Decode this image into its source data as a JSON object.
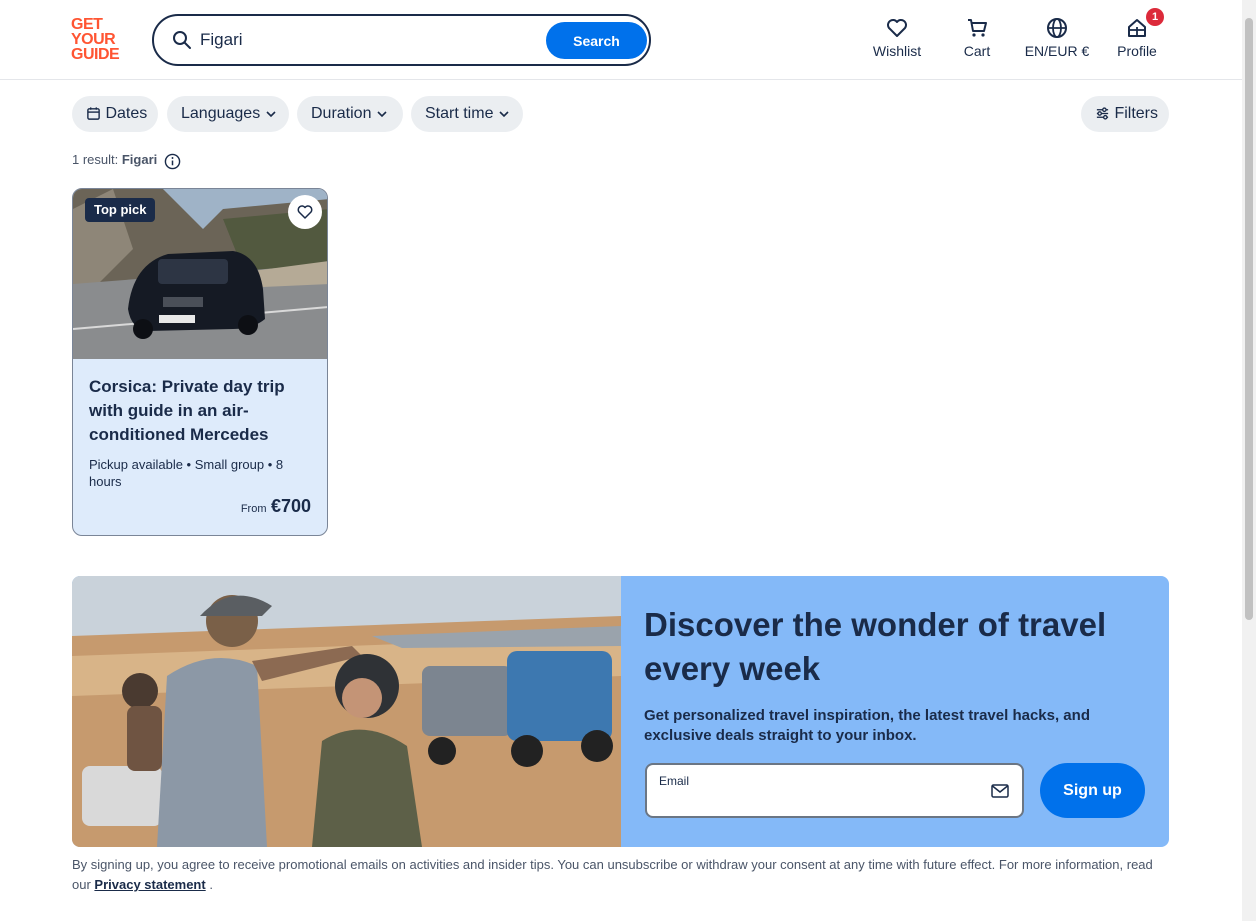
{
  "header": {
    "logo_lines": [
      "GET",
      "YOUR",
      "GUIDE"
    ],
    "search": {
      "value": "Figari",
      "button_label": "Search"
    },
    "nav": {
      "wishlist": "Wishlist",
      "cart": "Cart",
      "language": "EN/EUR €",
      "profile": "Profile",
      "profile_badge": "1"
    }
  },
  "filters": {
    "dates": "Dates",
    "languages": "Languages",
    "duration": "Duration",
    "start_time": "Start time",
    "more": "Filters"
  },
  "results": {
    "prefix": "1 result: ",
    "query": "Figari"
  },
  "cards": [
    {
      "badge": "Top pick",
      "title": "Corsica: Private day trip with guide in an air-conditioned Mercedes",
      "meta": "Pickup available • Small group • 8 hours",
      "price_prefix": "From",
      "price": "€700"
    }
  ],
  "newsletter": {
    "title": "Discover the wonder of travel every week",
    "subtitle": "Get personalized travel inspiration, the latest travel hacks, and exclusive deals straight to your inbox.",
    "email_label": "Email",
    "email_value": "",
    "button_label": "Sign up"
  },
  "legal": {
    "text": "By signing up, you agree to receive promotional emails on activities and insider tips. You can unsubscribe or withdraw your consent at any time with future effect. For more information, read our",
    "link": "Privacy statement",
    "suffix": " ."
  },
  "colors": {
    "brand": "#ff5533",
    "primary": "#0071eb",
    "text": "#1a2b49",
    "banner_bg": "#84b9f8",
    "card_bg": "#deebfb",
    "badge": "#dc2a3a"
  }
}
